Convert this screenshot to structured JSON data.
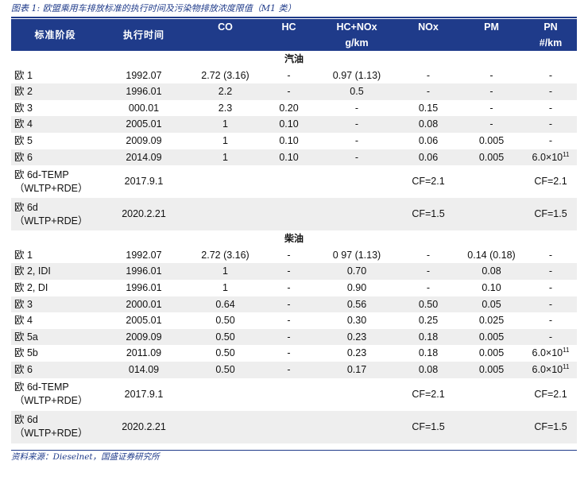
{
  "caption": "图表 1: 欧盟乘用车排放标准的执行时间及污染物排放浓度限值（M1 类）",
  "header": {
    "stage": "标准阶段",
    "date": "执行时间",
    "co": "CO",
    "hc": "HC",
    "hcnox": "HC+NOx",
    "unit": "g/km",
    "nox": "NOx",
    "pm": "PM",
    "pn": "PN",
    "pn_unit": "#/km"
  },
  "sections": {
    "gasoline": "汽油",
    "diesel": "柴油"
  },
  "gasoline_rows": [
    {
      "stage": "欧 1",
      "date": "1992.07",
      "co": "2.72 (3.16)",
      "hc": "-",
      "hcnox": "0.97 (1.13)",
      "nox": "-",
      "pm": "-",
      "pn": "-"
    },
    {
      "stage": "欧 2",
      "date": "1996.01",
      "co": "2.2",
      "hc": "-",
      "hcnox": "0.5",
      "nox": "-",
      "pm": "-",
      "pn": "-"
    },
    {
      "stage": "欧 3",
      "date": "000.01",
      "co": "2.3",
      "hc": "0.20",
      "hcnox": "-",
      "nox": "0.15",
      "pm": "-",
      "pn": "-"
    },
    {
      "stage": "欧 4",
      "date": "2005.01",
      "co": "1",
      "hc": "0.10",
      "hcnox": "-",
      "nox": "0.08",
      "pm": "-",
      "pn": "-"
    },
    {
      "stage": "欧 5",
      "date": "2009.09",
      "co": "1",
      "hc": "0.10",
      "hcnox": "-",
      "nox": "0.06",
      "pm": "0.005",
      "pn": "-"
    },
    {
      "stage": "欧 6",
      "date": "2014.09",
      "co": "1",
      "hc": "0.10",
      "hcnox": "-",
      "nox": "0.06",
      "pm": "0.005",
      "pn_base": "6.0×10",
      "pn_exp": "11"
    }
  ],
  "gasoline_cf_rows": [
    {
      "stage_line1": "欧 6d-TEMP",
      "stage_line2": "（WLTP+RDE）",
      "date": "2017.9.1",
      "nox": "CF=2.1",
      "pn": "CF=2.1"
    },
    {
      "stage_line1": "欧 6d",
      "stage_line2": "（WLTP+RDE）",
      "date": "2020.2.21",
      "nox": "CF=1.5",
      "pn": "CF=1.5"
    }
  ],
  "diesel_rows": [
    {
      "stage": "欧 1",
      "date": "1992.07",
      "co": "2.72 (3.16)",
      "hc": "-",
      "hcnox": "0 97 (1.13)",
      "nox": "-",
      "pm": "0.14 (0.18)",
      "pn": "-"
    },
    {
      "stage": "欧 2, IDI",
      "date": "1996.01",
      "co": "1",
      "hc": "-",
      "hcnox": "0.70",
      "nox": "-",
      "pm": "0.08",
      "pn": "-"
    },
    {
      "stage": "欧 2, DI",
      "date": "1996.01",
      "co": "1",
      "hc": "-",
      "hcnox": "0.90",
      "nox": "-",
      "pm": "0.10",
      "pn": "-"
    },
    {
      "stage": "欧 3",
      "date": "2000.01",
      "co": "0.64",
      "hc": "-",
      "hcnox": "0.56",
      "nox": "0.50",
      "pm": "0.05",
      "pn": "-"
    },
    {
      "stage": "欧 4",
      "date": "2005.01",
      "co": "0.50",
      "hc": "-",
      "hcnox": "0.30",
      "nox": "0.25",
      "pm": "0.025",
      "pn": "-"
    },
    {
      "stage": "欧 5a",
      "date": "2009.09",
      "co": "0.50",
      "hc": "-",
      "hcnox": "0.23",
      "nox": "0.18",
      "pm": "0.005",
      "pn": "-"
    },
    {
      "stage": "欧 5b",
      "date": "2011.09",
      "co": "0.50",
      "hc": "-",
      "hcnox": "0.23",
      "nox": "0.18",
      "pm": "0.005",
      "pn_base": "6.0×10",
      "pn_exp": "11"
    },
    {
      "stage": "欧 6",
      "date": "014.09",
      "co": "0.50",
      "hc": "-",
      "hcnox": "0.17",
      "nox": "0.08",
      "pm": "0.005",
      "pn_base": "6.0×10",
      "pn_exp": "11"
    }
  ],
  "diesel_cf_rows": [
    {
      "stage_line1": "欧 6d-TEMP",
      "stage_line2": "（WLTP+RDE）",
      "date": "2017.9.1",
      "nox": "CF=2.1",
      "pn": "CF=2.1"
    },
    {
      "stage_line1": "欧 6d",
      "stage_line2": "（WLTP+RDE）",
      "date": "2020.2.21",
      "nox": "CF=1.5",
      "pn": "CF=1.5"
    }
  ],
  "source": "资料来源：Dieselnet，国盛证券研究所",
  "colors": {
    "header_bg": "#1f3b8a",
    "alt_row": "#eeeeee",
    "caption": "#1f3b8a"
  }
}
